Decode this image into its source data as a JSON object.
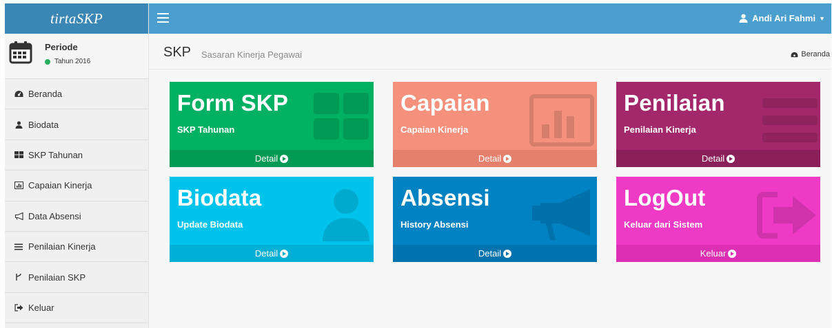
{
  "app": {
    "brand": "tirtaSKP"
  },
  "user": {
    "name": "Andi Ari Fahmi"
  },
  "periode": {
    "title": "Periode",
    "year": "Tahun 2016"
  },
  "sidebar": {
    "items": [
      {
        "label": "Beranda",
        "icon": "dashboard-icon"
      },
      {
        "label": "Biodata",
        "icon": "user-icon"
      },
      {
        "label": "SKP Tahunan",
        "icon": "grid-icon"
      },
      {
        "label": "Capaian Kinerja",
        "icon": "bar-chart-icon"
      },
      {
        "label": "Data Absensi",
        "icon": "bullhorn-icon"
      },
      {
        "label": "Penilaian Kinerja",
        "icon": "list-icon"
      },
      {
        "label": "Penilaian SKP",
        "icon": "code-fork-icon"
      },
      {
        "label": "Keluar",
        "icon": "sign-out-icon"
      }
    ]
  },
  "page": {
    "title": "SKP",
    "subtitle": "Sasaran Kinerja Pegawai",
    "breadcrumb": "Beranda"
  },
  "tiles": [
    {
      "title": "Form SKP",
      "subtitle": "SKP Tahunan",
      "action": "Detail",
      "color": "#00b063",
      "footer_color": "#009a55",
      "icon": "grid-icon"
    },
    {
      "title": "Capaian",
      "subtitle": "Capaian Kinerja",
      "action": "Detail",
      "color": "#f4907c",
      "footer_color": "#e5806d",
      "icon": "bar-chart-icon"
    },
    {
      "title": "Penilaian",
      "subtitle": "Penilaian Kinerja",
      "action": "Detail",
      "color": "#a3286b",
      "footer_color": "#8b1f5a",
      "icon": "list-icon"
    },
    {
      "title": "Biodata",
      "subtitle": "Update Biodata",
      "action": "Detail",
      "color": "#00c3ec",
      "footer_color": "#00afd6",
      "icon": "user-icon"
    },
    {
      "title": "Absensi",
      "subtitle": "History Absensi",
      "action": "Detail",
      "color": "#0082c3",
      "footer_color": "#0072ad",
      "icon": "bullhorn-icon"
    },
    {
      "title": "LogOut",
      "subtitle": "Keluar dari Sistem",
      "action": "Keluar",
      "color": "#ef3ac6",
      "footer_color": "#dc2fb4",
      "icon": "sign-out-icon"
    }
  ]
}
